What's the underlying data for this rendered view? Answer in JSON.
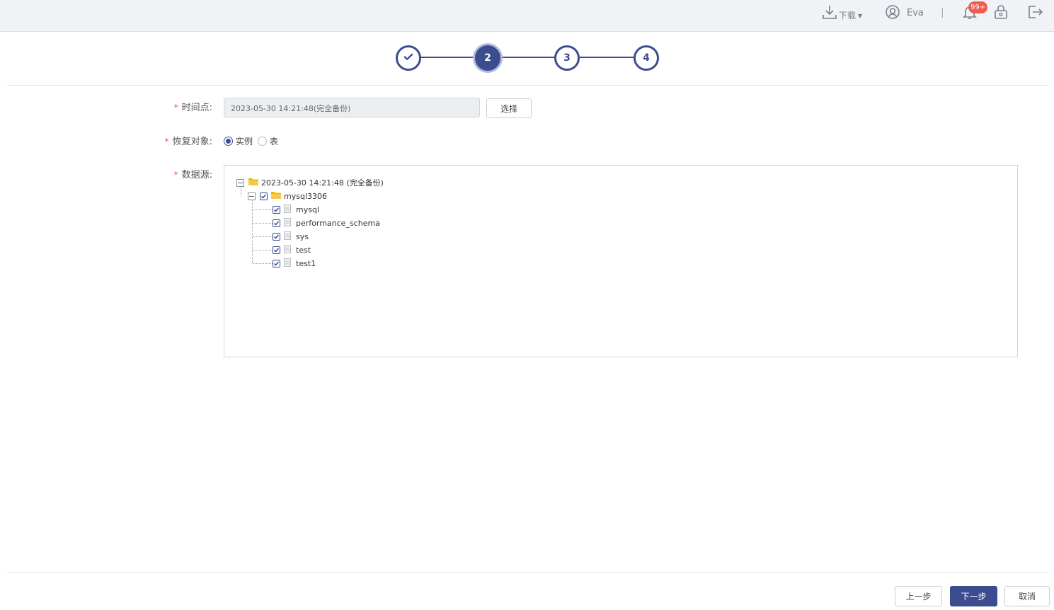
{
  "header": {
    "download_label": "下载",
    "user_name": "Eva",
    "separator": "|",
    "notification_badge": "99+"
  },
  "steps": [
    "2",
    "3",
    "4"
  ],
  "form": {
    "time_point": {
      "label": "时间点:",
      "value": "2023-05-30 14:21:48(完全备份)",
      "select_button": "选择"
    },
    "restore_target": {
      "label": "恢复对象:",
      "options": [
        "实例",
        "表"
      ],
      "selected": "实例"
    },
    "datasource": {
      "label": "数据源:",
      "tree": {
        "root": "2023-05-30 14:21:48 (完全备份)",
        "instance": "mysql3306",
        "databases": [
          "mysql",
          "performance_schema",
          "sys",
          "test",
          "test1"
        ]
      }
    }
  },
  "footer": {
    "prev_label": "上一步",
    "next_label": "下一步",
    "cancel_label": "取消"
  },
  "colors": {
    "primary": "#3c4d8f",
    "required_star": "#f25a4f",
    "folder": "#f2b705"
  }
}
